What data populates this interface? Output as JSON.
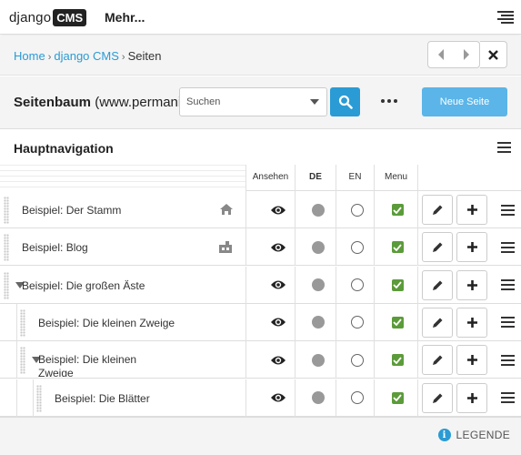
{
  "toolbar": {
    "logo_text": "django",
    "logo_badge": "CMS",
    "more_label": "Mehr..."
  },
  "breadcrumb": {
    "items": [
      "Home",
      "django CMS",
      "Seiten"
    ]
  },
  "page_tree": {
    "title": "Seitenbaum",
    "site": "(www.permanio.de)",
    "search_placeholder": "Suchen",
    "new_page_label": "Neue Seite",
    "section_title": "Hauptnavigation",
    "columns": {
      "view": "Ansehen",
      "lang_de": "DE",
      "lang_en": "EN",
      "menu": "Menu"
    },
    "rows": [
      {
        "title": "Beispiel: Der Stamm",
        "level": 0,
        "expanded": null,
        "icon": "home-icon",
        "de_published": true,
        "en_published": false,
        "in_menu": true
      },
      {
        "title": "Beispiel: Blog",
        "level": 0,
        "expanded": null,
        "icon": "apphook-icon",
        "de_published": true,
        "en_published": false,
        "in_menu": true
      },
      {
        "title": "Beispiel: Die großen Äste",
        "level": 0,
        "expanded": true,
        "icon": "",
        "de_published": true,
        "en_published": false,
        "in_menu": true
      },
      {
        "title": "Beispiel: Die kleinen Zweige",
        "level": 1,
        "expanded": null,
        "icon": "",
        "de_published": true,
        "en_published": false,
        "in_menu": true
      },
      {
        "title": "Beispiel: Die kleinen Zweige",
        "level": 1,
        "expanded": true,
        "icon": "",
        "de_published": true,
        "en_published": false,
        "in_menu": true
      },
      {
        "title": "Beispiel: Die Blätter",
        "level": 2,
        "expanded": null,
        "icon": "",
        "de_published": true,
        "en_published": false,
        "in_menu": true
      }
    ]
  },
  "footer": {
    "legend_label": "LEGENDE"
  },
  "colors": {
    "link": "#2a9bd4",
    "new_page_button": "#5bb5e8",
    "checkbox": "#5c9b3a",
    "published_dot": "#999999"
  }
}
